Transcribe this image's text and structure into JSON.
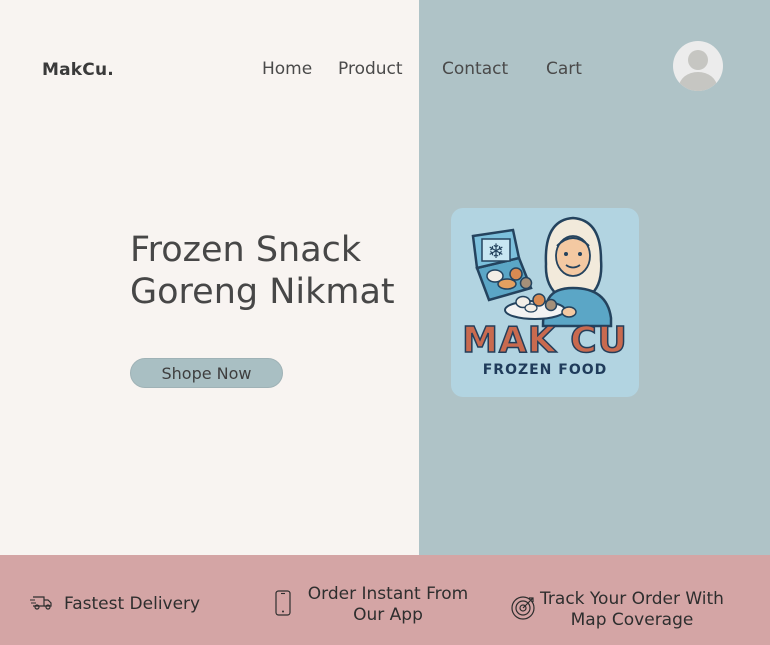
{
  "brand": "MakCu.",
  "nav": {
    "home": "Home",
    "product": "Product",
    "contact": "Contact",
    "cart": "Cart"
  },
  "hero": {
    "title_line1": "Frozen Snack",
    "title_line2": "Goreng Nikmat",
    "cta_label": "Shope Now"
  },
  "logo": {
    "main_text": "MAK CU",
    "sub_text": "FROZEN FOOD"
  },
  "features": [
    {
      "label": "Fastest Delivery",
      "icon": "delivery-truck-icon"
    },
    {
      "label_line1": "Order Instant From",
      "label_line2": "Our App",
      "icon": "smartphone-icon"
    },
    {
      "label_line1": "Track Your Order With",
      "label_line2": "Map Coverage",
      "icon": "radar-target-icon"
    }
  ],
  "colors": {
    "left_bg": "#f8f4f1",
    "right_bg": "#afc3c7",
    "footer_bg": "#d4a5a5",
    "button_bg": "#a9bfc3",
    "logo_bg": "#b2d4e1",
    "logo_text": "#c96a4f"
  }
}
